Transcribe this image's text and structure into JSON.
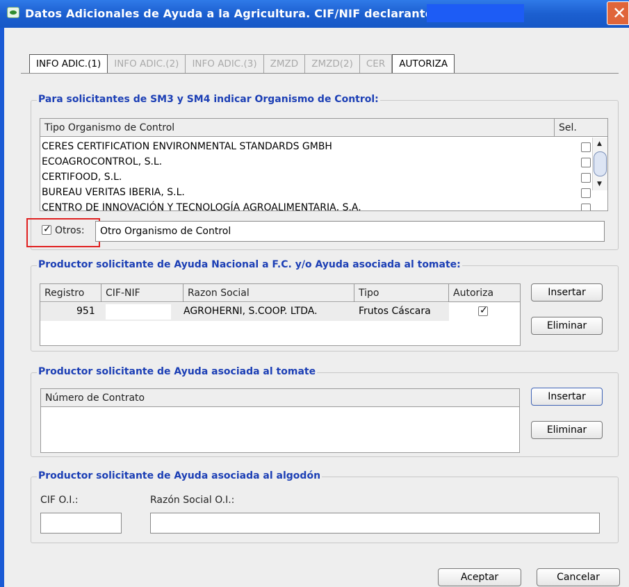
{
  "window": {
    "title": "Datos Adicionales de Ayuda a la Agricultura. CIF/NIF declarante:",
    "close_label": "✕"
  },
  "tabs": [
    {
      "label": "INFO ADIC.(1)",
      "state": "active"
    },
    {
      "label": "INFO ADIC.(2)",
      "state": "disabled"
    },
    {
      "label": "INFO ADIC.(3)",
      "state": "disabled"
    },
    {
      "label": "ZMZD",
      "state": "disabled"
    },
    {
      "label": "ZMZD(2)",
      "state": "disabled"
    },
    {
      "label": "CER",
      "state": "disabled"
    },
    {
      "label": "AUTORIZA",
      "state": "enabled"
    }
  ],
  "control_section": {
    "legend": "Para solicitantes de SM3 y SM4 indicar Organismo de Control:",
    "col_tipo": "Tipo Organismo de Control",
    "col_sel": "Sel.",
    "rows": [
      "CERES CERTIFICATION ENVIRONMENTAL STANDARDS GMBH",
      "ECOAGROCONTROL, S.L.",
      "CERTIFOOD, S.L.",
      "BUREAU VERITAS IBERIA, S.L.",
      "CENTRO DE INNOVACIÓN Y TECNOLOGÍA AGROALIMENTARIA, S.A."
    ],
    "otros_label": "Otros:",
    "otros_checked": true,
    "otros_value": "Otro Organismo de Control"
  },
  "nacional_section": {
    "legend": "Productor solicitante de Ayuda Nacional a F.C. y/o Ayuda asociada al tomate:",
    "columns": [
      "Registro",
      "CIF-NIF",
      "Razon Social",
      "Tipo",
      "Autoriza"
    ],
    "row": {
      "registro": "951",
      "cif": "",
      "razon": "AGROHERNI, S.COOP. LTDA.",
      "tipo": "Frutos Cáscara",
      "autoriza": true
    },
    "insert_label": "Insertar",
    "delete_label": "Eliminar"
  },
  "tomate_section": {
    "legend": "Productor solicitante de Ayuda asociada al tomate",
    "column": "Número de Contrato",
    "insert_label": "Insertar",
    "delete_label": "Eliminar"
  },
  "algodon_section": {
    "legend": "Productor solicitante de Ayuda asociada al algodón",
    "cif_label": "CIF O.I.:",
    "razon_label": "Razón Social O.I.:",
    "cif_value": "",
    "razon_value": ""
  },
  "footer": {
    "accept_label": "Aceptar",
    "cancel_label": "Cancelar"
  }
}
